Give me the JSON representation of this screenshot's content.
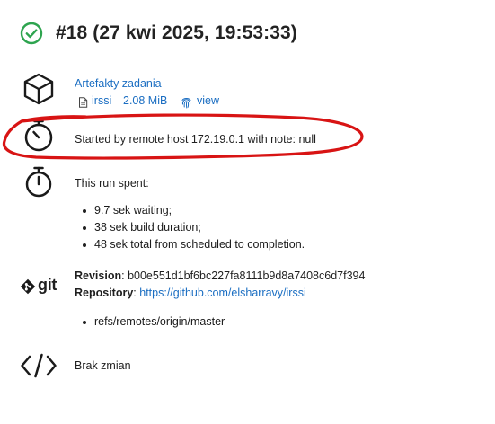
{
  "build": {
    "title": "#18 (27 kwi 2025, 19:53:33)",
    "status_icon": "check-circle-icon",
    "status_color": "#2ea44f"
  },
  "artifacts": {
    "heading": "Artefakty zadania",
    "file_name": "irssi",
    "file_size": "2.08 MiB",
    "view_label": "view"
  },
  "cause": {
    "text": "Started by remote host 172.19.0.1 with note: null"
  },
  "timing": {
    "heading": "This run spent:",
    "items": [
      "9.7 sek waiting;",
      "38 sek build duration;",
      "48 sek total from scheduled to completion."
    ]
  },
  "git": {
    "logo_text": "git",
    "revision_label": "Revision",
    "revision_value": "b00e551d1bf6bc227fa8111b9d8a7408c6d7f394",
    "repository_label": "Repository",
    "repository_url": "https://github.com/elsharravy/irssi",
    "branches": [
      "refs/remotes/origin/master"
    ]
  },
  "changes": {
    "text": "Brak zmian"
  },
  "annotation_color": "#d81414"
}
